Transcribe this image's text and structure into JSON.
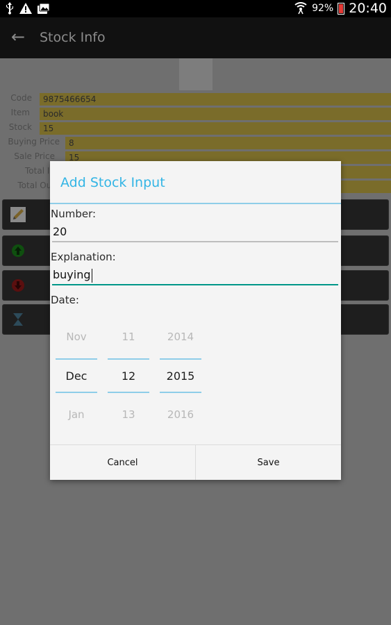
{
  "status_bar": {
    "battery_percent": "92%",
    "time": "20:40"
  },
  "action_bar": {
    "title": "Stock Info"
  },
  "stock_form": {
    "fields": [
      {
        "label": "Code",
        "value": "9875466654"
      },
      {
        "label": "Item",
        "value": "book"
      },
      {
        "label": "Stock",
        "value": "15"
      },
      {
        "label": "Buying Price",
        "value": "8"
      },
      {
        "label": "Sale Price",
        "value": "15"
      },
      {
        "label": "Total In",
        "value": ""
      },
      {
        "label": "Total Out",
        "value": ""
      }
    ]
  },
  "dialog": {
    "title": "Add Stock Input",
    "number_label": "Number:",
    "number_value": "20",
    "explanation_label": "Explanation:",
    "explanation_value": "buying",
    "date_label": "Date:",
    "date_picker": {
      "month": {
        "prev": "Nov",
        "selected": "Dec",
        "next": "Jan"
      },
      "day": {
        "prev": "11",
        "selected": "12",
        "next": "13"
      },
      "year": {
        "prev": "2014",
        "selected": "2015",
        "next": "2016"
      }
    },
    "cancel_label": "Cancel",
    "save_label": "Save"
  },
  "colors": {
    "accent": "#33b5e5",
    "focus_underline": "#009688"
  }
}
